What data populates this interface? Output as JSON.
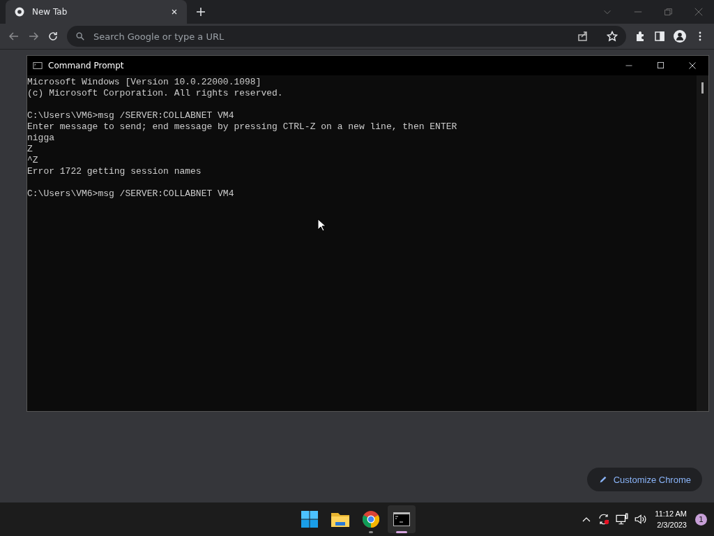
{
  "browser": {
    "tabs": [
      {
        "title": "New Tab",
        "selected": true
      }
    ],
    "omnibox": {
      "placeholder": "Search Google or type a URL"
    },
    "customize_button": "Customize Chrome"
  },
  "console_window": {
    "title": "Command Prompt",
    "blocks": [
      [
        "Microsoft Windows [Version 10.0.22000.1098]",
        "(c) Microsoft Corporation. All rights reserved."
      ],
      [
        "C:\\Users\\VM6>msg /SERVER:COLLABNET VM4",
        "Enter message to send; end message by pressing CTRL-Z on a new line, then ENTER",
        "nigga",
        "Z",
        "^Z",
        "Error 1722 getting session names"
      ],
      [
        "C:\\Users\\VM6>msg /SERVER:COLLABNET VM4"
      ]
    ]
  },
  "taskbar": {
    "apps": [
      {
        "kind": "start",
        "running": false,
        "selected": false
      },
      {
        "kind": "explorer",
        "running": false,
        "selected": false
      },
      {
        "kind": "chrome",
        "running": true,
        "selected": false
      },
      {
        "kind": "terminal",
        "running": true,
        "selected": true
      }
    ],
    "time": "11:12 AM",
    "date": "2/3/2023",
    "notification_count": "1"
  }
}
